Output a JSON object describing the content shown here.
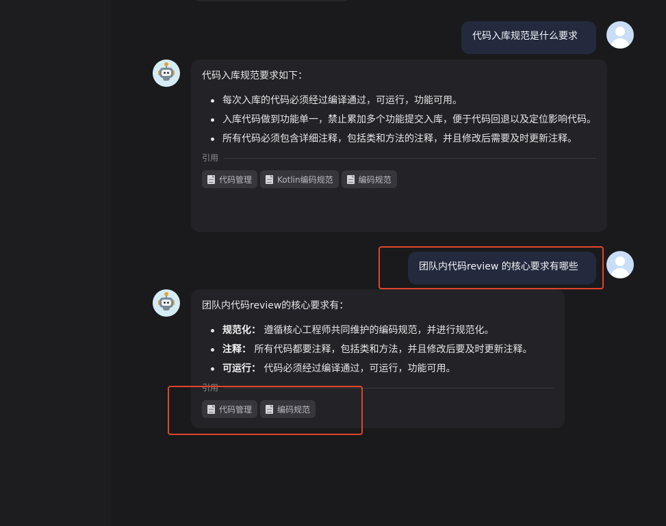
{
  "conversation": {
    "msg1_user": "代码入库规范是什么要求",
    "msg1_bot": {
      "intro": "代码入库规范要求如下：",
      "items": [
        "每次入库的代码必须经过编译通过，可运行，功能可用。",
        "入库代码做到功能单一，禁止累加多个功能提交入库，便于代码回退以及定位影响代码。",
        "所有代码必须包含详细注释，包括类和方法的注释，并且修改后需要及时更新注释。"
      ],
      "ref_label": "引用",
      "refs": [
        "代码管理",
        "Kotlin编码规范",
        "编码规范"
      ]
    },
    "msg2_user": "团队内代码review 的核心要求有哪些",
    "msg2_bot": {
      "intro": "团队内代码review的核心要求有：",
      "items": [
        {
          "term": "规范化：",
          "text": " 遵循核心工程师共同维护的编码规范，并进行规范化。"
        },
        {
          "term": "注释：",
          "text": " 所有代码都要注释，包括类和方法，并且修改后要及时更新注释。"
        },
        {
          "term": "可运行：",
          "text": " 代码必须经过编译通过，可运行，功能可用。"
        }
      ],
      "ref_label": "引用",
      "refs": [
        "代码管理",
        "编码规范"
      ]
    }
  },
  "icons": {
    "user_avatar": "user-avatar-icon",
    "bot_avatar": "robot-avatar-icon",
    "doc": "document-icon"
  },
  "colors": {
    "background": "#1a1a1c",
    "user_bubble": "#232a3e",
    "bot_bubble": "#232327",
    "chip": "#36363b",
    "highlight": "#e2452d"
  }
}
